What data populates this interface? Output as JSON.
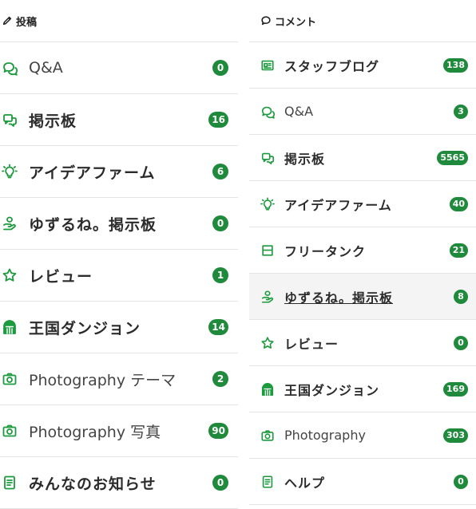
{
  "posts": {
    "header": "投稿",
    "items": [
      {
        "icon": "qa-icon",
        "label": "Q&A",
        "count": "0",
        "bold": false
      },
      {
        "icon": "board-icon",
        "label": "掲示板",
        "count": "16",
        "bold": true
      },
      {
        "icon": "idea-icon",
        "label": "アイデアファーム",
        "count": "6",
        "bold": true
      },
      {
        "icon": "yuzurune-icon",
        "label": "ゆずるね。掲示板",
        "count": "0",
        "bold": true
      },
      {
        "icon": "star-icon",
        "label": "レビュー",
        "count": "1",
        "bold": true
      },
      {
        "icon": "dungeon-icon",
        "label": "王国ダンジョン",
        "count": "14",
        "bold": true
      },
      {
        "icon": "camera-icon",
        "label": "Photography テーマ",
        "count": "2",
        "bold": false
      },
      {
        "icon": "camera-icon",
        "label": "Photography 写真",
        "count": "90",
        "bold": false
      },
      {
        "icon": "notice-icon",
        "label": "みんなのお知らせ",
        "count": "0",
        "bold": true
      }
    ]
  },
  "comments": {
    "header": "コメント",
    "items": [
      {
        "icon": "news-icon",
        "label": "スタッフブログ",
        "count": "138",
        "bold": true
      },
      {
        "icon": "qa-icon",
        "label": "Q&A",
        "count": "3",
        "bold": false
      },
      {
        "icon": "board-icon",
        "label": "掲示板",
        "count": "5565",
        "bold": true
      },
      {
        "icon": "idea-icon",
        "label": "アイデアファーム",
        "count": "40",
        "bold": true
      },
      {
        "icon": "tank-icon",
        "label": "フリータンク",
        "count": "21",
        "bold": true
      },
      {
        "icon": "yuzurune-icon",
        "label": "ゆずるね。掲示板",
        "count": "8",
        "bold": true,
        "active": true
      },
      {
        "icon": "star-icon",
        "label": "レビュー",
        "count": "0",
        "bold": true
      },
      {
        "icon": "dungeon-icon",
        "label": "王国ダンジョン",
        "count": "169",
        "bold": true
      },
      {
        "icon": "camera-icon",
        "label": "Photography",
        "count": "303",
        "bold": false
      },
      {
        "icon": "notice-icon",
        "label": "ヘルプ",
        "count": "0",
        "bold": true
      }
    ]
  },
  "colors": {
    "accent": "#1c9a3e",
    "badge": "#1f8a3b"
  }
}
